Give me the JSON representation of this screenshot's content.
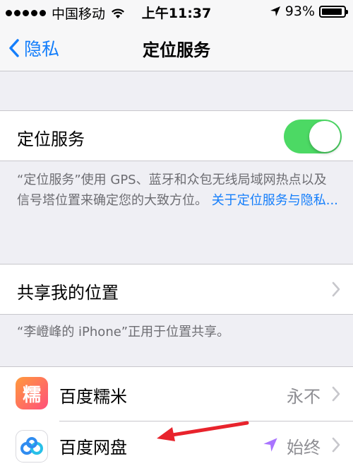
{
  "status_bar": {
    "carrier": "中国移动",
    "time": "上午11:37",
    "battery_percent": "93%",
    "battery_level": 0.93
  },
  "nav": {
    "back_label": "隐私",
    "title": "定位服务"
  },
  "location_services": {
    "label": "定位服务",
    "enabled": true,
    "description": "“定位服务”使用 GPS、蓝牙和众包无线局域网热点以及信号塔位置来确定您的大致方位。",
    "link": "关于定位服务与隐私..."
  },
  "share_location": {
    "label": "共享我的位置",
    "footer": "“李嶝峰的 iPhone”正用于位置共享。"
  },
  "apps": [
    {
      "name": "百度糯米",
      "permission": "永不",
      "icon": "baidu-nuomi-icon",
      "icon_text": "糯",
      "color": "#ff5b6e"
    },
    {
      "name": "百度网盘",
      "permission": "始终",
      "icon": "baidu-netdisk-icon",
      "color": "#2f8cf0"
    }
  ],
  "colors": {
    "accent": "#147efb",
    "toggle_on": "#4cd964",
    "background": "#efeff4"
  }
}
